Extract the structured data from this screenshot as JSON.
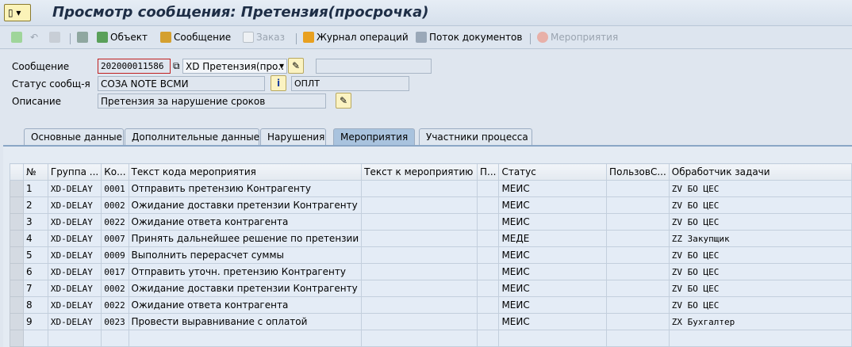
{
  "window": {
    "title": "Просмотр сообщения: Претензия(просрочка)"
  },
  "toolbar": {
    "object": "Объект",
    "message": "Сообщение",
    "order": "Заказ",
    "journal": "Журнал операций",
    "doc_flow": "Поток документов",
    "activities": "Мероприятия"
  },
  "header": {
    "message_label": "Сообщение",
    "message_value": "202000011586",
    "message_type": "XD Претензия(про..",
    "status_label": "Статус сообщ-я",
    "status_value": "СОЗА NOTE ВСМИ",
    "status_code": "ОПЛТ",
    "desc_label": "Описание",
    "desc_value": "Претензия за нарушение сроков"
  },
  "tabs": [
    "Основные данные",
    "Дополнительные данные",
    "Нарушения",
    "Мероприятия",
    "Участники процесса"
  ],
  "active_tab": "Мероприятия",
  "table": {
    "columns": [
      "№",
      "Группа ...",
      "Ко...",
      "Текст кода мероприятия",
      "Текст к мероприятию",
      "П...",
      "Статус",
      "ПользовС...",
      "Обработчик задачи"
    ],
    "rows": [
      [
        "1",
        "XD-DELAY",
        "0001",
        "Отправить претензию Контрагенту",
        "",
        "",
        "МЕИС",
        "",
        "ZV БО ЦЕС"
      ],
      [
        "2",
        "XD-DELAY",
        "0002",
        "Ожидание доставки претензии Контрагенту",
        "",
        "",
        "МЕИС",
        "",
        "ZV БО ЦЕС"
      ],
      [
        "3",
        "XD-DELAY",
        "0022",
        "Ожидание ответа контрагента",
        "",
        "",
        "МЕИС",
        "",
        "ZV БО ЦЕС"
      ],
      [
        "4",
        "XD-DELAY",
        "0007",
        "Принять дальнейшее решение по претензии",
        "",
        "",
        "МЕДЕ",
        "",
        "ZZ Закупщик"
      ],
      [
        "5",
        "XD-DELAY",
        "0009",
        "Выполнить перерасчет суммы",
        "",
        "",
        "МЕИС",
        "",
        "ZV БО ЦЕС"
      ],
      [
        "6",
        "XD-DELAY",
        "0017",
        "Отправить уточн. претензию Контрагенту",
        "",
        "",
        "МЕИС",
        "",
        "ZV БО ЦЕС"
      ],
      [
        "7",
        "XD-DELAY",
        "0002",
        "Ожидание доставки претензии Контрагенту",
        "",
        "",
        "МЕИС",
        "",
        "ZV БО ЦЕС"
      ],
      [
        "8",
        "XD-DELAY",
        "0022",
        "Ожидание ответа контрагента",
        "",
        "",
        "МЕИС",
        "",
        "ZV БО ЦЕС"
      ],
      [
        "9",
        "XD-DELAY",
        "0023",
        "Провести выравнивание с оплатой",
        "",
        "",
        "МЕИС",
        "",
        "ZX Бухгалтер"
      ]
    ]
  }
}
